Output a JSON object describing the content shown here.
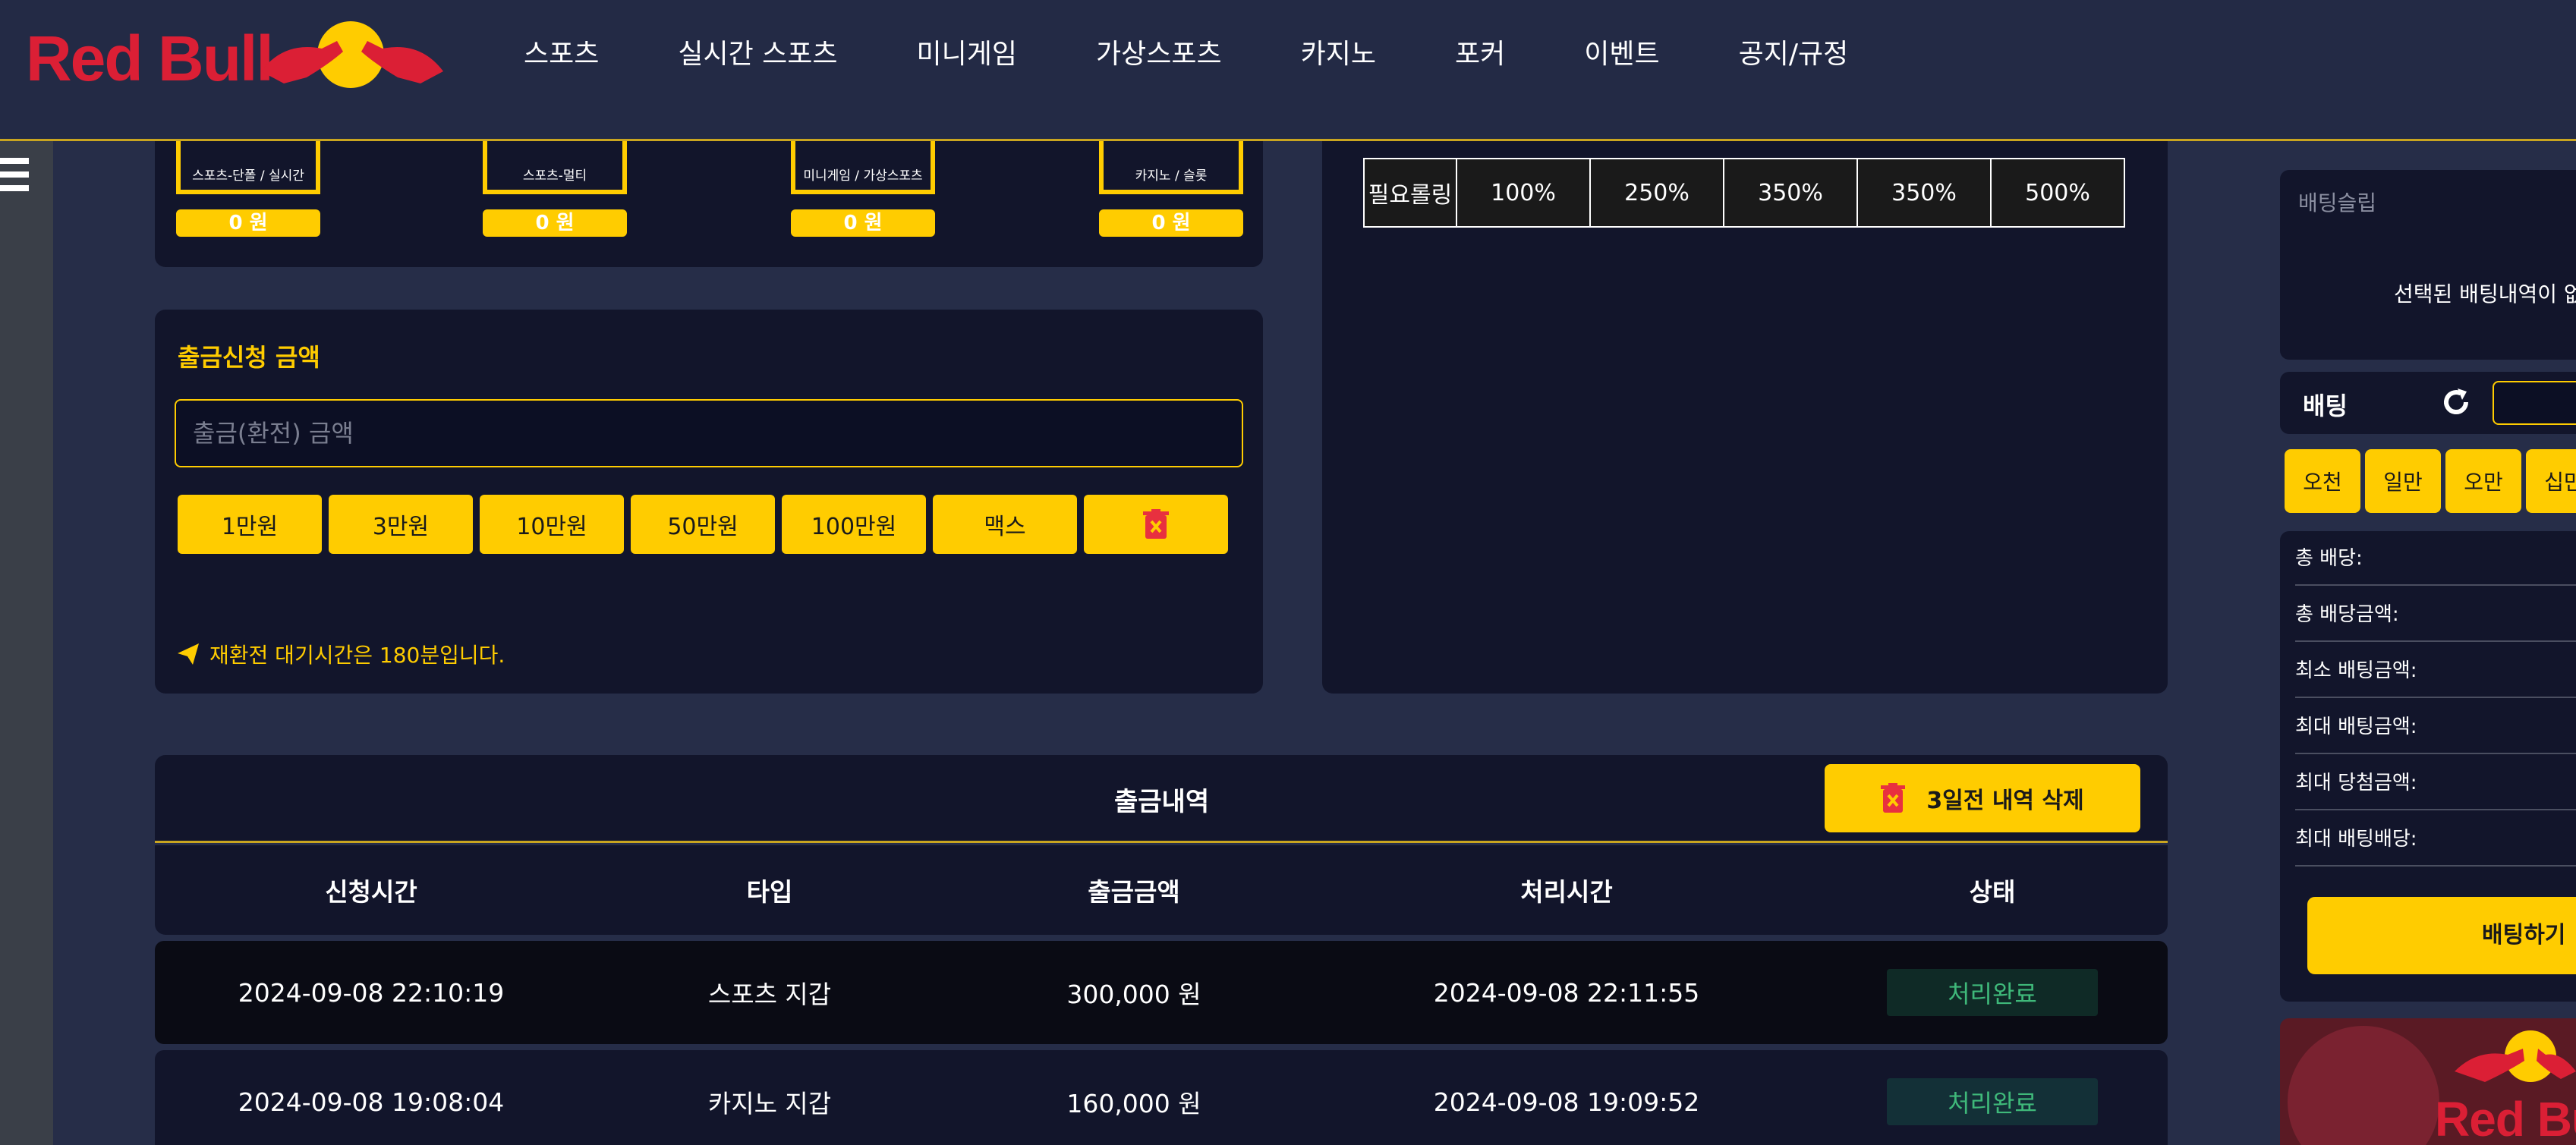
{
  "header": {
    "logo_text": "Red Bull",
    "nav": [
      "스포츠",
      "실시간 스포츠",
      "미니게임",
      "가상스포츠",
      "카지노",
      "포커",
      "이벤트",
      "공지/규정"
    ]
  },
  "wallets": [
    {
      "label": "스포츠-단폴 / 실시간",
      "amount": "0 원"
    },
    {
      "label": "스포츠-멀티",
      "amount": "0 원"
    },
    {
      "label": "미니게임 / 가상스포츠",
      "amount": "0 원"
    },
    {
      "label": "카지노 / 슬롯",
      "amount": "0 원"
    }
  ],
  "withdraw": {
    "title": "출금신청 금액",
    "placeholder": "출금(환전) 금액",
    "buttons": [
      "1만원",
      "3만원",
      "10만원",
      "50만원",
      "100만원",
      "맥스"
    ],
    "notice": "재환전 대기시간은 180분입니다."
  },
  "rolling": {
    "row_label": "필요롤링",
    "values": [
      "100%",
      "250%",
      "350%",
      "350%",
      "500%"
    ]
  },
  "betslip": {
    "title": "배팅슬립",
    "empty_text": "선택된 배팅내역이 없",
    "bet_label": "배팅",
    "chips": [
      "오천",
      "일만",
      "오만",
      "십만"
    ],
    "info_rows": [
      "총 배당:",
      "총 배당금액:",
      "최소 배팅금액:",
      "최대 배팅금액:",
      "최대 당첨금액:",
      "최대 배팅배당:"
    ],
    "submit_label": "배팅하기",
    "promo_text": "Red Bu"
  },
  "history": {
    "title": "출금내역",
    "delete_label": "3일전 내역 삭제",
    "columns": [
      "신청시간",
      "타입",
      "출금금액",
      "처리시간",
      "상태"
    ],
    "rows": [
      {
        "time": "2024-09-08 22:10:19",
        "type": "스포츠 지갑",
        "amount": "300,000 원",
        "processed": "2024-09-08 22:11:55",
        "status": "처리완료"
      },
      {
        "time": "2024-09-08 19:08:04",
        "type": "카지노 지갑",
        "amount": "160,000 원",
        "processed": "2024-09-08 19:09:52",
        "status": "처리완료"
      }
    ]
  },
  "colors": {
    "accent": "#ffcc00",
    "panel": "#12152b",
    "background": "#262d48",
    "status_green": "#3fb97a"
  }
}
